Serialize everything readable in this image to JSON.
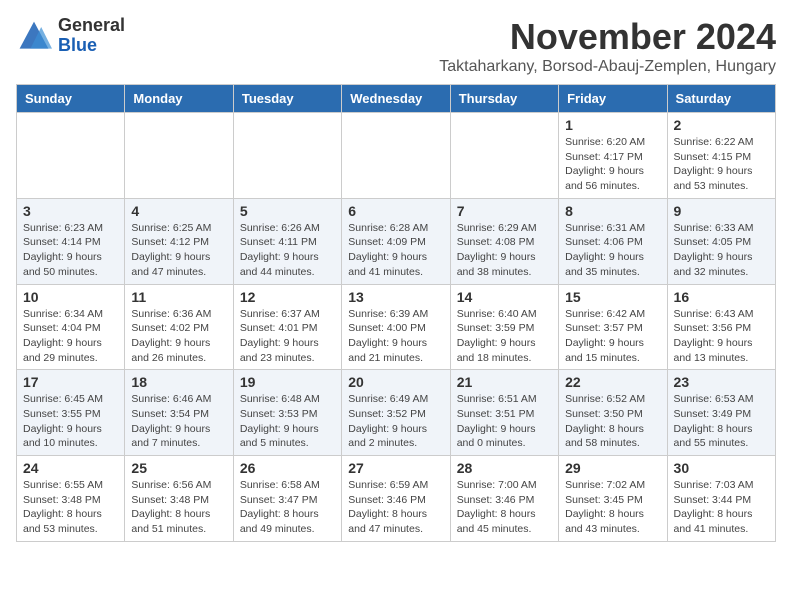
{
  "header": {
    "logo_general": "General",
    "logo_blue": "Blue",
    "main_title": "November 2024",
    "subtitle": "Taktaharkany, Borsod-Abauj-Zemplen, Hungary"
  },
  "columns": [
    "Sunday",
    "Monday",
    "Tuesday",
    "Wednesday",
    "Thursday",
    "Friday",
    "Saturday"
  ],
  "weeks": [
    {
      "days": [
        {
          "num": "",
          "info": ""
        },
        {
          "num": "",
          "info": ""
        },
        {
          "num": "",
          "info": ""
        },
        {
          "num": "",
          "info": ""
        },
        {
          "num": "",
          "info": ""
        },
        {
          "num": "1",
          "info": "Sunrise: 6:20 AM\nSunset: 4:17 PM\nDaylight: 9 hours and 56 minutes."
        },
        {
          "num": "2",
          "info": "Sunrise: 6:22 AM\nSunset: 4:15 PM\nDaylight: 9 hours and 53 minutes."
        }
      ]
    },
    {
      "days": [
        {
          "num": "3",
          "info": "Sunrise: 6:23 AM\nSunset: 4:14 PM\nDaylight: 9 hours and 50 minutes."
        },
        {
          "num": "4",
          "info": "Sunrise: 6:25 AM\nSunset: 4:12 PM\nDaylight: 9 hours and 47 minutes."
        },
        {
          "num": "5",
          "info": "Sunrise: 6:26 AM\nSunset: 4:11 PM\nDaylight: 9 hours and 44 minutes."
        },
        {
          "num": "6",
          "info": "Sunrise: 6:28 AM\nSunset: 4:09 PM\nDaylight: 9 hours and 41 minutes."
        },
        {
          "num": "7",
          "info": "Sunrise: 6:29 AM\nSunset: 4:08 PM\nDaylight: 9 hours and 38 minutes."
        },
        {
          "num": "8",
          "info": "Sunrise: 6:31 AM\nSunset: 4:06 PM\nDaylight: 9 hours and 35 minutes."
        },
        {
          "num": "9",
          "info": "Sunrise: 6:33 AM\nSunset: 4:05 PM\nDaylight: 9 hours and 32 minutes."
        }
      ]
    },
    {
      "days": [
        {
          "num": "10",
          "info": "Sunrise: 6:34 AM\nSunset: 4:04 PM\nDaylight: 9 hours and 29 minutes."
        },
        {
          "num": "11",
          "info": "Sunrise: 6:36 AM\nSunset: 4:02 PM\nDaylight: 9 hours and 26 minutes."
        },
        {
          "num": "12",
          "info": "Sunrise: 6:37 AM\nSunset: 4:01 PM\nDaylight: 9 hours and 23 minutes."
        },
        {
          "num": "13",
          "info": "Sunrise: 6:39 AM\nSunset: 4:00 PM\nDaylight: 9 hours and 21 minutes."
        },
        {
          "num": "14",
          "info": "Sunrise: 6:40 AM\nSunset: 3:59 PM\nDaylight: 9 hours and 18 minutes."
        },
        {
          "num": "15",
          "info": "Sunrise: 6:42 AM\nSunset: 3:57 PM\nDaylight: 9 hours and 15 minutes."
        },
        {
          "num": "16",
          "info": "Sunrise: 6:43 AM\nSunset: 3:56 PM\nDaylight: 9 hours and 13 minutes."
        }
      ]
    },
    {
      "days": [
        {
          "num": "17",
          "info": "Sunrise: 6:45 AM\nSunset: 3:55 PM\nDaylight: 9 hours and 10 minutes."
        },
        {
          "num": "18",
          "info": "Sunrise: 6:46 AM\nSunset: 3:54 PM\nDaylight: 9 hours and 7 minutes."
        },
        {
          "num": "19",
          "info": "Sunrise: 6:48 AM\nSunset: 3:53 PM\nDaylight: 9 hours and 5 minutes."
        },
        {
          "num": "20",
          "info": "Sunrise: 6:49 AM\nSunset: 3:52 PM\nDaylight: 9 hours and 2 minutes."
        },
        {
          "num": "21",
          "info": "Sunrise: 6:51 AM\nSunset: 3:51 PM\nDaylight: 9 hours and 0 minutes."
        },
        {
          "num": "22",
          "info": "Sunrise: 6:52 AM\nSunset: 3:50 PM\nDaylight: 8 hours and 58 minutes."
        },
        {
          "num": "23",
          "info": "Sunrise: 6:53 AM\nSunset: 3:49 PM\nDaylight: 8 hours and 55 minutes."
        }
      ]
    },
    {
      "days": [
        {
          "num": "24",
          "info": "Sunrise: 6:55 AM\nSunset: 3:48 PM\nDaylight: 8 hours and 53 minutes."
        },
        {
          "num": "25",
          "info": "Sunrise: 6:56 AM\nSunset: 3:48 PM\nDaylight: 8 hours and 51 minutes."
        },
        {
          "num": "26",
          "info": "Sunrise: 6:58 AM\nSunset: 3:47 PM\nDaylight: 8 hours and 49 minutes."
        },
        {
          "num": "27",
          "info": "Sunrise: 6:59 AM\nSunset: 3:46 PM\nDaylight: 8 hours and 47 minutes."
        },
        {
          "num": "28",
          "info": "Sunrise: 7:00 AM\nSunset: 3:46 PM\nDaylight: 8 hours and 45 minutes."
        },
        {
          "num": "29",
          "info": "Sunrise: 7:02 AM\nSunset: 3:45 PM\nDaylight: 8 hours and 43 minutes."
        },
        {
          "num": "30",
          "info": "Sunrise: 7:03 AM\nSunset: 3:44 PM\nDaylight: 8 hours and 41 minutes."
        }
      ]
    }
  ]
}
